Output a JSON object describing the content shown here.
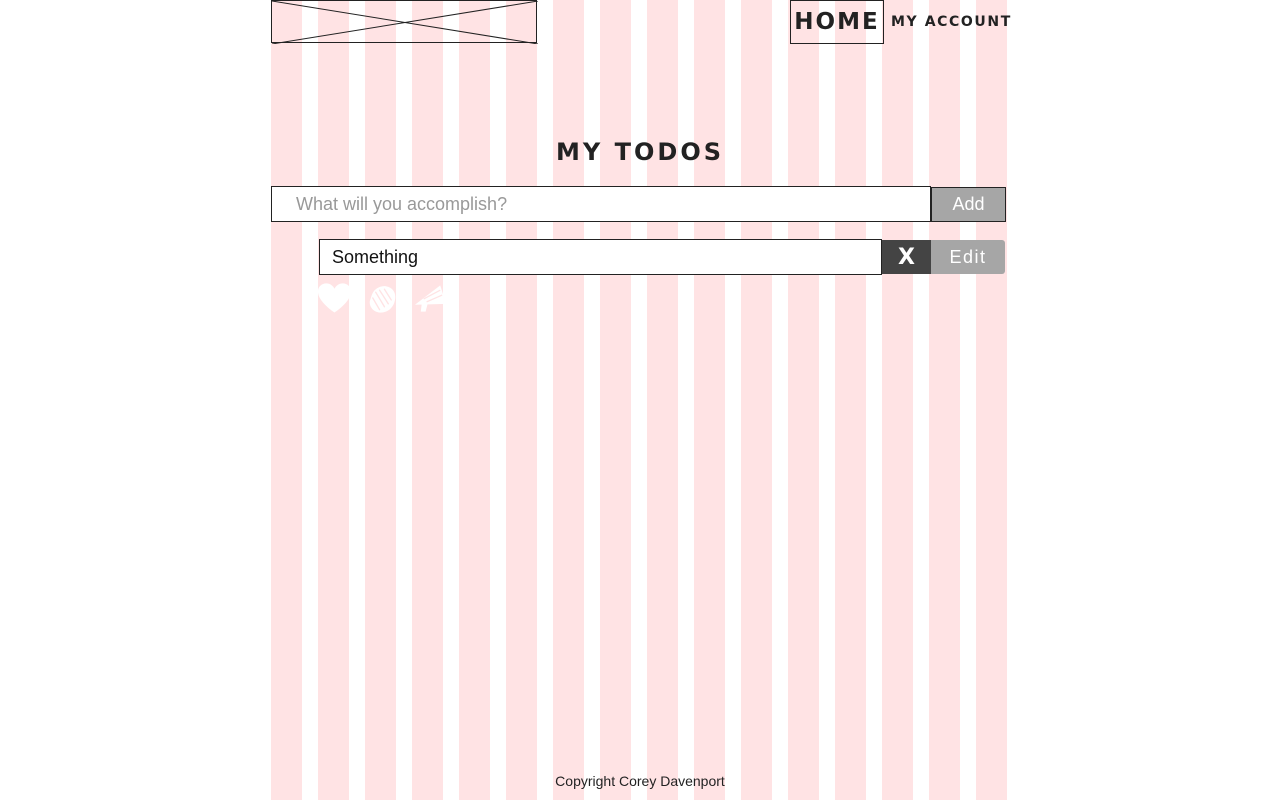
{
  "nav": {
    "home": "HOME",
    "account": "MY ACCOUNT"
  },
  "main": {
    "title": "MY TODOS",
    "new_todo": {
      "placeholder": "What will you accomplish?",
      "value": "",
      "add_label": "Add"
    },
    "todos": [
      {
        "text": "Something",
        "delete_label": "X",
        "edit_label": "Edit",
        "reactions": [
          "heart-icon",
          "clap-icon",
          "megaphone-icon"
        ]
      }
    ]
  },
  "footer": {
    "copyright": "Copyright Corey Davenport"
  },
  "colors": {
    "grid_column": "#ffe3e4",
    "button_gray": "#a6a6a6",
    "button_dark": "#444444",
    "text": "#222222"
  }
}
